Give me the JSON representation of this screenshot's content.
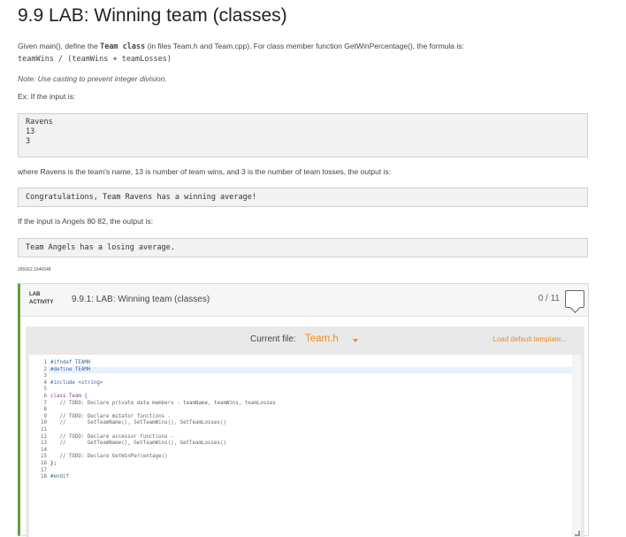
{
  "title": "9.9 LAB: Winning team (classes)",
  "intro": {
    "p1_before": "Given main(), define the ",
    "p1_code": "Team class",
    "p1_after": " (in files Team.h and Team.cpp). For class member function GetWinPercentage(), the formula is:",
    "formula": "teamWins / (teamWins + teamLosses)",
    "note": "Note: Use casting to prevent integer division.",
    "ex_label": "Ex: If the input is:",
    "input1": [
      "Ravens",
      "13",
      "3"
    ],
    "where_text": "where Ravens is the team's name, 13 is number of team wins, and 3 is the number of team losses, the output is:",
    "output1": "Congratulations, Team Ravens has a winning average!",
    "if_text": "If the input is Angels 80 82, the output is:",
    "output2": "Team Angels has a losing average.",
    "tiny_id": "265062.1646548"
  },
  "lab": {
    "tag_line1": "LAB",
    "tag_line2": "ACTIVITY",
    "title": "9.9.1: LAB: Winning team (classes)",
    "score": "0 / 11",
    "accent_color": "#5aa33c",
    "current_file_label": "Current file:",
    "current_file": "Team.h",
    "load_default": "Load default template...",
    "link_color": "#f28a1c"
  },
  "code": {
    "line_numbers": [
      "1",
      "2",
      "3",
      "4",
      "5",
      "6",
      "7",
      "8",
      "9",
      "10",
      "11",
      "12",
      "13",
      "14",
      "15",
      "16",
      "17",
      "18"
    ],
    "lines": [
      "#ifndef TEAMH",
      "#define TEAMH",
      "",
      "#include <string>",
      "",
      "class Team {",
      "   // TODO: Declare private data members - teamName, teamWins, teamLosses",
      "",
      "   // TODO: Declare mutator functions -",
      "   //       SetTeamName(), SetTeamWins(), SetTeamLosses()",
      "",
      "   // TODO: Declare accessor functions -",
      "   //       GetTeamName(), GetTeamWins(), GetTeamLosses()",
      "",
      "   // TODO: Declare GetWinPercentage()",
      "};",
      "",
      "#endif"
    ]
  }
}
